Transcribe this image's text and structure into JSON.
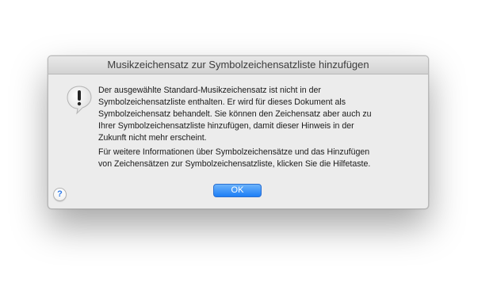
{
  "dialog": {
    "title": "Musikzeichensatz zur Symbolzeichensatzliste hinzufügen",
    "icon": "alert-icon",
    "message_1": "Der ausgewählte Standard-Musikzeichensatz ist nicht in der\nSymbolzeichensatzliste enthalten. Er wird für dieses Dokument als\nSymbolzeichensatz behandelt. Sie können den Zeichensatz aber auch zu\nIhrer Symbolzeichensatzliste hinzufügen, damit dieser Hinweis in der\nZukunft nicht mehr erscheint.",
    "message_2": "Für weitere Informationen über Symbolzeichensätze und das Hinzufügen\nvon Zeichensätzen zur Symbolzeichensatzliste, klicken Sie die Hilfetaste.",
    "ok_label": "OK",
    "help_label": "?",
    "help_icon": "help-icon",
    "accent_color": "#1d7ef6"
  }
}
